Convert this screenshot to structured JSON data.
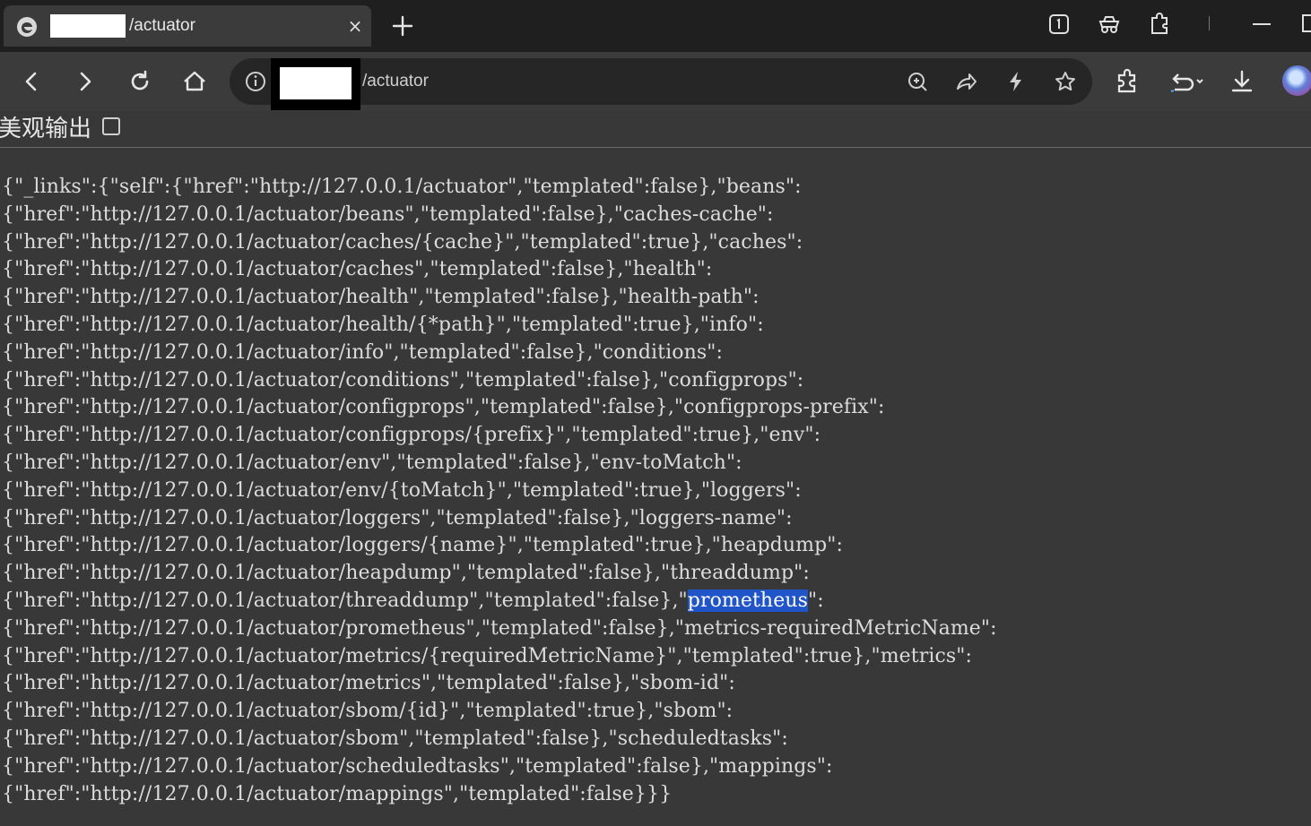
{
  "tab": {
    "title": "/actuator",
    "close_glyph": "×"
  },
  "address_bar": {
    "url_suffix": "/actuator"
  },
  "page": {
    "pretty_print_label": "美观输出",
    "pretty_print_checked": false,
    "highlight_color": "#1f55c8",
    "json_lines": [
      "{\"_links\":{\"self\":{\"href\":\"http://127.0.0.1/actuator\",\"templated\":false},\"beans\":",
      "{\"href\":\"http://127.0.0.1/actuator/beans\",\"templated\":false},\"caches-cache\":",
      "{\"href\":\"http://127.0.0.1/actuator/caches/{cache}\",\"templated\":true},\"caches\":",
      "{\"href\":\"http://127.0.0.1/actuator/caches\",\"templated\":false},\"health\":",
      "{\"href\":\"http://127.0.0.1/actuator/health\",\"templated\":false},\"health-path\":",
      "{\"href\":\"http://127.0.0.1/actuator/health/{*path}\",\"templated\":true},\"info\":",
      "{\"href\":\"http://127.0.0.1/actuator/info\",\"templated\":false},\"conditions\":",
      "{\"href\":\"http://127.0.0.1/actuator/conditions\",\"templated\":false},\"configprops\":",
      "{\"href\":\"http://127.0.0.1/actuator/configprops\",\"templated\":false},\"configprops-prefix\":",
      "{\"href\":\"http://127.0.0.1/actuator/configprops/{prefix}\",\"templated\":true},\"env\":",
      "{\"href\":\"http://127.0.0.1/actuator/env\",\"templated\":false},\"env-toMatch\":",
      "{\"href\":\"http://127.0.0.1/actuator/env/{toMatch}\",\"templated\":true},\"loggers\":",
      "{\"href\":\"http://127.0.0.1/actuator/loggers\",\"templated\":false},\"loggers-name\":",
      "{\"href\":\"http://127.0.0.1/actuator/loggers/{name}\",\"templated\":true},\"heapdump\":",
      "{\"href\":\"http://127.0.0.1/actuator/heapdump\",\"templated\":false},\"threaddump\":",
      "{\"href\":\"http://127.0.0.1/actuator/threaddump\",\"templated\":false},\"prometheus\":",
      "{\"href\":\"http://127.0.0.1/actuator/prometheus\",\"templated\":false},\"metrics-requiredMetricName\":",
      "{\"href\":\"http://127.0.0.1/actuator/metrics/{requiredMetricName}\",\"templated\":true},\"metrics\":",
      "{\"href\":\"http://127.0.0.1/actuator/metrics\",\"templated\":false},\"sbom-id\":",
      "{\"href\":\"http://127.0.0.1/actuator/sbom/{id}\",\"templated\":true},\"sbom\":",
      "{\"href\":\"http://127.0.0.1/actuator/sbom\",\"templated\":false},\"scheduledtasks\":",
      "{\"href\":\"http://127.0.0.1/actuator/scheduledtasks\",\"templated\":false},\"mappings\":",
      "{\"href\":\"http://127.0.0.1/actuator/mappings\",\"templated\":false}}}"
    ],
    "selection": {
      "line": 15,
      "text": "prometheus"
    }
  },
  "icons": {
    "tab_favicon": "edge-favicon-icon",
    "new_tab": "plus-icon",
    "tab_actions": "tab-actions-icon",
    "copilot": "copilot-icon",
    "extensions": "puzzle-icon",
    "minimize": "minimize-icon",
    "maximize": "maximize-icon",
    "back": "back-arrow-icon",
    "forward": "forward-arrow-icon",
    "refresh": "refresh-icon",
    "home": "home-icon",
    "site_info": "info-icon",
    "zoom": "zoom-icon",
    "share": "share-icon",
    "extension_bolt": "bolt-icon",
    "favorite": "star-icon",
    "puzzle_toolbar": "extensions-icon",
    "history_back": "undo-history-icon",
    "download": "download-icon",
    "profile": "profile-avatar-icon"
  }
}
